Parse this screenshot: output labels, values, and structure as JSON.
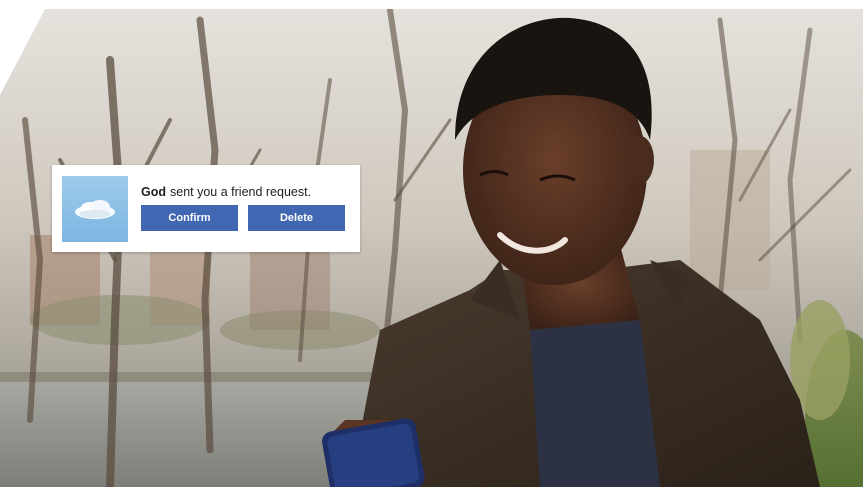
{
  "notification": {
    "sender": "God",
    "message": "sent you a friend request.",
    "confirm_label": "Confirm",
    "delete_label": "Delete",
    "avatar_icon": "cloud-icon"
  },
  "colors": {
    "button_blue": "#4267b2",
    "card_background": "#ffffff",
    "text_dark": "#1c1e21"
  },
  "photo": {
    "subject_icon": "man-with-phone-illustration",
    "background_icon": "park-trees-illustration"
  }
}
